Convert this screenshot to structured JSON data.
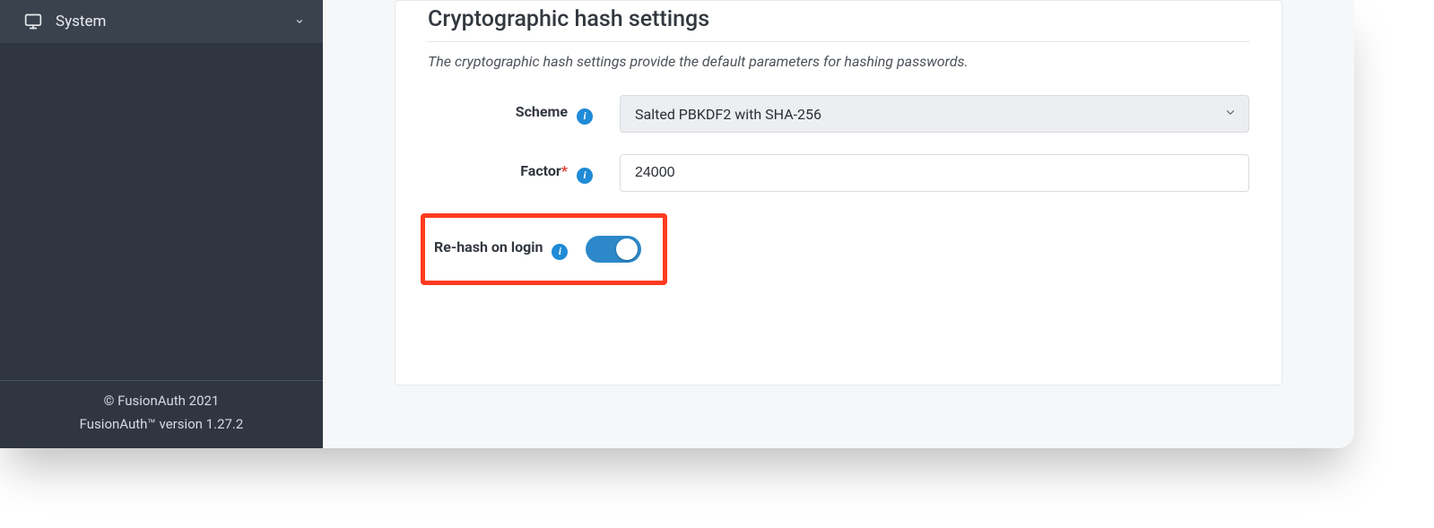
{
  "sidebar": {
    "item_system": "System"
  },
  "footer": {
    "copyright": "© FusionAuth 2021",
    "version": "FusionAuth™ version 1.27.2"
  },
  "section": {
    "title": "Cryptographic hash settings",
    "description": "The cryptographic hash settings provide the default parameters for hashing passwords."
  },
  "fields": {
    "scheme": {
      "label": "Scheme",
      "value": "Salted PBKDF2 with SHA-256"
    },
    "factor": {
      "label": "Factor",
      "required_marker": "*",
      "value": "24000"
    },
    "rehash": {
      "label": "Re-hash on login",
      "enabled": true
    }
  },
  "icons": {
    "info_glyph": "i"
  }
}
